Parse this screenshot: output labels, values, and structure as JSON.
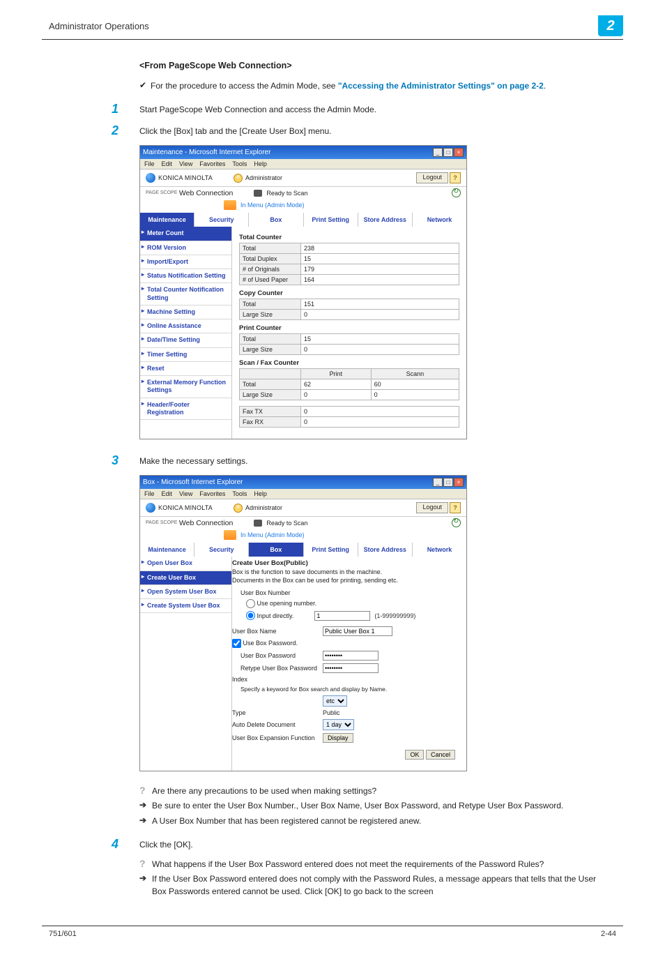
{
  "header": {
    "section": "Administrator Operations",
    "chapter": "2"
  },
  "subhead": "<From PageScope Web Connection>",
  "checkrow": {
    "prefix": "For the procedure to access the Admin Mode, see ",
    "link": "\"Accessing the Administrator Settings\" on page 2-2",
    "suffix": "."
  },
  "steps": {
    "s1num": "1",
    "s1": "Start PageScope Web Connection and access the Admin Mode.",
    "s2num": "2",
    "s2": "Click the [Box] tab and the [Create User Box] menu.",
    "s3num": "3",
    "s3": "Make the necessary settings.",
    "s4num": "4",
    "s4": "Click the [OK]."
  },
  "shot1": {
    "title": "Maintenance - Microsoft Internet Explorer",
    "menus": [
      "File",
      "Edit",
      "View",
      "Favorites",
      "Tools",
      "Help"
    ],
    "brand": "KONICA MINOLTA",
    "role": "Administrator",
    "logout": "Logout",
    "webconn_prefix": "PAGE SCOPE",
    "webconn": "Web Connection",
    "status": "Ready to Scan",
    "modeline": "In Menu (Admin Mode)",
    "tabs": [
      "Maintenance",
      "Security",
      "Box",
      "Print Setting",
      "Store Address",
      "Network"
    ],
    "side": [
      "Meter Count",
      "ROM Version",
      "Import/Export",
      "Status Notification Setting",
      "Total Counter Notification Setting",
      "Machine Setting",
      "Online Assistance",
      "Date/Time Setting",
      "Timer Setting",
      "Reset",
      "External Memory Function Settings",
      "Header/Footer Registration"
    ],
    "sect_total": "Total Counter",
    "tc": [
      [
        "Total",
        "238"
      ],
      [
        "Total Duplex",
        "15"
      ],
      [
        "# of Originals",
        "179"
      ],
      [
        "# of Used Paper",
        "164"
      ]
    ],
    "sect_copy": "Copy Counter",
    "cc": [
      [
        "Total",
        "151"
      ],
      [
        "Large Size",
        "0"
      ]
    ],
    "sect_print": "Print Counter",
    "pc": [
      [
        "Total",
        "15"
      ],
      [
        "Large Size",
        "0"
      ]
    ],
    "sect_sf": "Scan / Fax Counter",
    "sf_hdr": [
      "",
      "Print",
      "Scann"
    ],
    "sf": [
      [
        "Total",
        "62",
        "60"
      ],
      [
        "Large Size",
        "0",
        "0"
      ]
    ],
    "fax": [
      [
        "Fax TX",
        "0"
      ],
      [
        "Fax RX",
        "0"
      ]
    ]
  },
  "shot2": {
    "title": "Box - Microsoft Internet Explorer",
    "side": [
      "Open User Box",
      "Create User Box",
      "Open System User Box",
      "Create System User Box"
    ],
    "heading": "Create User Box(Public)",
    "desc1": "Box is the function to save documents in the machine.",
    "desc2": "Documents in the Box can be used for printing, sending etc.",
    "lbl_ubn": "User Box Number",
    "radio1": "Use opening number.",
    "radio2": "Input directly.",
    "ubn_val": "1",
    "ubn_range": "(1-999999999)",
    "lbl_name": "User Box Name",
    "name_val": "Public User Box 1",
    "cb_usepass": "Use Box Password.",
    "lbl_pass": "User Box Password",
    "lbl_rpass": "Retype User Box Password",
    "lbl_index": "Index",
    "index_desc": "Specify a keyword for Box search and display by Name.",
    "index_val": "etc",
    "lbl_type": "Type",
    "type_val": "Public",
    "lbl_auto": "Auto Delete Document",
    "auto_val": "1 day",
    "lbl_exp": "User Box Expansion Function",
    "display_btn": "Display",
    "ok": "OK",
    "cancel": "Cancel"
  },
  "qa": {
    "q1": "Are there any precautions to be used when making settings?",
    "a1": "Be sure to enter the User Box Number., User Box Name, User Box Password, and Retype User Box Password.",
    "a2": "A User Box Number that has been registered cannot be registered anew.",
    "q2": "What happens if the User Box Password entered does not meet the requirements of the Password Rules?",
    "a3": "If the User Box Password entered does not comply with the Password Rules, a message appears that tells that the User Box Passwords entered cannot be used. Click [OK] to go back to the screen"
  },
  "footer": {
    "left": "751/601",
    "right": "2-44"
  }
}
